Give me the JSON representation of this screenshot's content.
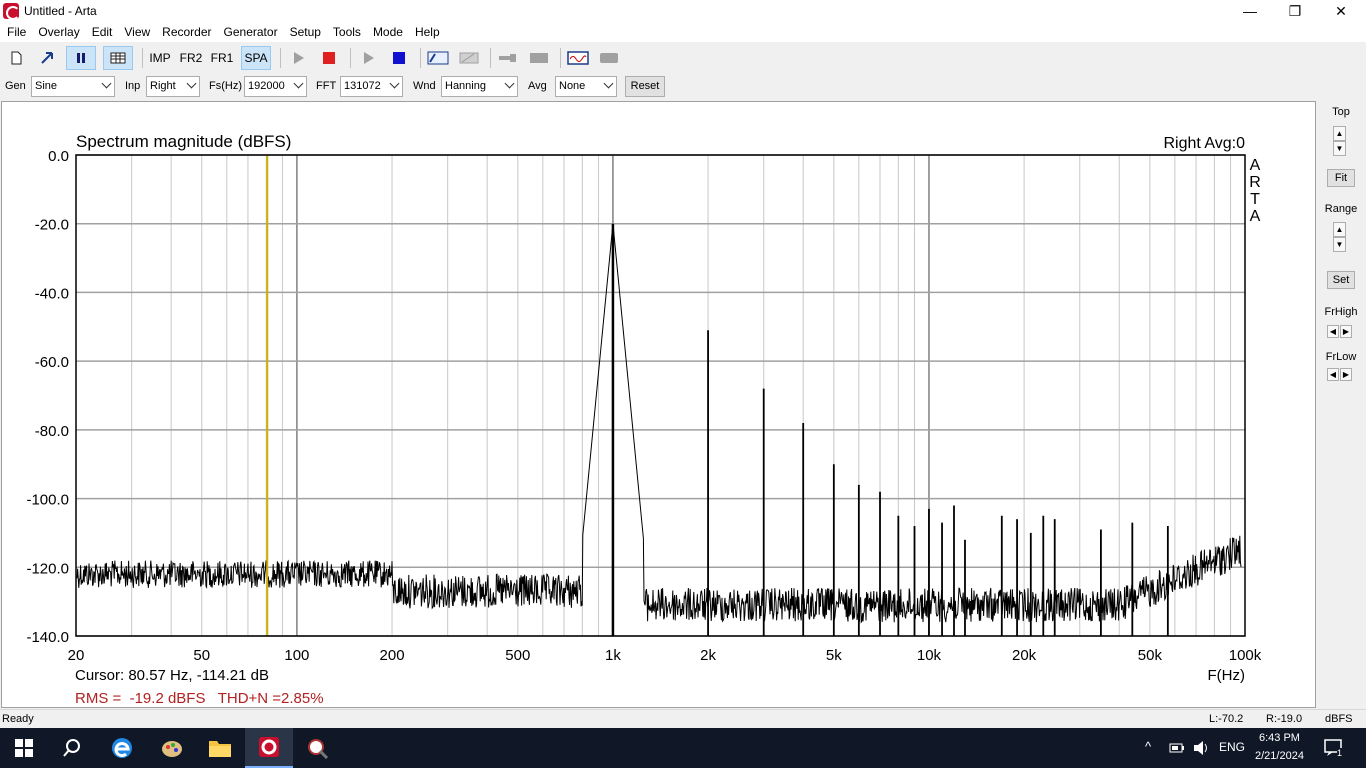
{
  "window": {
    "title": "Untitled - Arta",
    "minimize": "—",
    "maximize": "❐",
    "close": "✕"
  },
  "menu": [
    "File",
    "Overlay",
    "Edit",
    "View",
    "Recorder",
    "Generator",
    "Setup",
    "Tools",
    "Mode",
    "Help"
  ],
  "toolbar": {
    "imp_label": "IMP",
    "fr2_label": "FR2",
    "fr1_label": "FR1",
    "spa_label": "SPA",
    "icons": [
      "new-doc-icon",
      "open-icon",
      "pause-icon",
      "table-icon",
      "play-icon",
      "stop-icon",
      "play-icon",
      "stop-icon",
      "abc-icon",
      "edit-icon",
      "key-icon",
      "rect-icon",
      "scope-icon",
      "rect-icon"
    ]
  },
  "controls": {
    "gen_label": "Gen",
    "gen_value": "Sine",
    "inp_label": "Inp",
    "inp_value": "Right",
    "fs_label": "Fs(Hz)",
    "fs_value": "192000",
    "fft_label": "FFT",
    "fft_value": "131072",
    "wnd_label": "Wnd",
    "wnd_value": "Hanning",
    "avg_label": "Avg",
    "avg_value": "None",
    "reset_label": "Reset"
  },
  "plot": {
    "heading": "Spectrum magnitude (dBFS)",
    "channel_info": "Right  Avg:0",
    "watermark": [
      "A",
      "R",
      "T",
      "A"
    ],
    "cursor": "Cursor: 80.57 Hz, -114.21 dB",
    "rms": "RMS =  -19.2 dBFS   THD+N =2.85%",
    "x_axis_label": "F(Hz)"
  },
  "chart_data": {
    "type": "line",
    "title": "Spectrum magnitude (dBFS)",
    "xlabel": "F(Hz)",
    "ylabel": "",
    "x_scale": "log",
    "xlim": [
      20,
      100000
    ],
    "ylim": [
      -140,
      0
    ],
    "x_ticks": [
      20,
      50,
      100,
      200,
      500,
      1000,
      2000,
      5000,
      10000,
      20000,
      50000,
      100000
    ],
    "x_tick_labels": [
      "20",
      "50",
      "100",
      "200",
      "500",
      "1k",
      "2k",
      "5k",
      "10k",
      "20k",
      "50k",
      "100k"
    ],
    "y_ticks": [
      0,
      -20,
      -40,
      -60,
      -80,
      -100,
      -120,
      -140
    ],
    "y_tick_labels": [
      "0.0",
      "-20.0",
      "-40.0",
      "-60.0",
      "-80.0",
      "-100.0",
      "-120.0",
      "-140.0"
    ],
    "grid": true,
    "cursor_hz": 80.57,
    "cursor_db": -114.21,
    "noise_floor_db": -126,
    "harmonics": [
      {
        "hz": 1000,
        "db": -20
      },
      {
        "hz": 2000,
        "db": -51
      },
      {
        "hz": 3000,
        "db": -68
      },
      {
        "hz": 4000,
        "db": -78
      },
      {
        "hz": 5000,
        "db": -90
      },
      {
        "hz": 6000,
        "db": -96
      },
      {
        "hz": 7000,
        "db": -98
      },
      {
        "hz": 8000,
        "db": -105
      },
      {
        "hz": 9000,
        "db": -108
      },
      {
        "hz": 10000,
        "db": -103
      },
      {
        "hz": 11000,
        "db": -107
      },
      {
        "hz": 12000,
        "db": -102
      },
      {
        "hz": 13000,
        "db": -112
      },
      {
        "hz": 17000,
        "db": -105
      },
      {
        "hz": 19000,
        "db": -106
      },
      {
        "hz": 21000,
        "db": -110
      },
      {
        "hz": 23000,
        "db": -105
      },
      {
        "hz": 25000,
        "db": -106
      },
      {
        "hz": 35000,
        "db": -109
      },
      {
        "hz": 44000,
        "db": -107
      },
      {
        "hz": 57000,
        "db": -108
      }
    ]
  },
  "rightpanel": {
    "top_label": "Top",
    "fit_label": "Fit",
    "range_label": "Range",
    "set_label": "Set",
    "frhigh_label": "FrHigh",
    "frlow_label": "FrLow"
  },
  "status": {
    "text": "Ready",
    "left_level": "L:-70.2",
    "right_level": "R:-19.0",
    "unit": "dBFS"
  },
  "taskbar": {
    "lang": "ENG",
    "time": "6:43 PM",
    "date": "2/21/2024",
    "notification_count": "1"
  },
  "colors": {
    "cursor_line": "#c8b400",
    "rms_text": "#b22222",
    "grid": "#a0a0a0",
    "trace": "#000000"
  }
}
